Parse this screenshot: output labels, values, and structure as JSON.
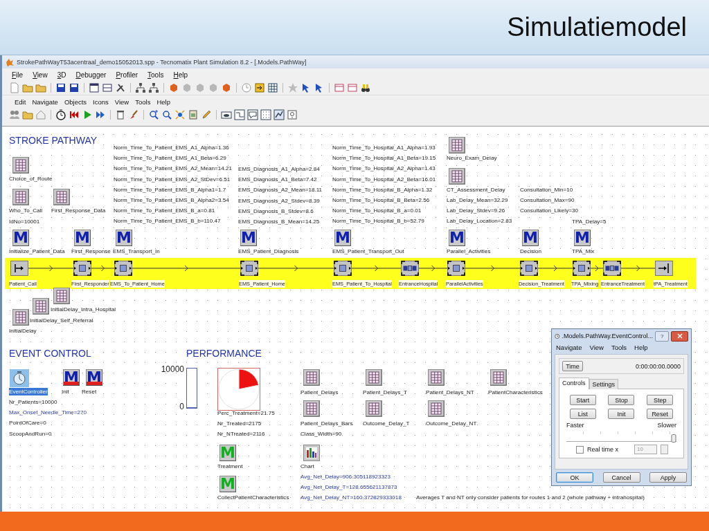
{
  "slide": {
    "title": "Simulatiemodel"
  },
  "window": {
    "title": "StrokePathWayT53acentraal_demo15052013.spp - Tecnomatix Plant Simulation 8.2 - [.Models.PathWay]",
    "menu": [
      "File",
      "View",
      "3D",
      "Debugger",
      "Profiler",
      "Tools",
      "Help"
    ]
  },
  "frame_menu": [
    "Edit",
    "Navigate",
    "Objects",
    "Icons",
    "View",
    "Tools",
    "Help"
  ],
  "canvas": {
    "headings": [
      "STROKE PATHWAY",
      "EVENT CONTROL",
      "PERFORMANCE"
    ],
    "text_blocks": [
      {
        "lines": [
          {
            "text": "IdNo=10001",
            "kind": "plain"
          }
        ]
      },
      {
        "lines": [
          {
            "text": "Norm_Time_To_Patient_EMS_A1_Alpha=1.36",
            "kind": "plain"
          },
          {
            "text": "Norm_Time_To_Patient_EMS_A1_Beta=6.29",
            "kind": "plain"
          },
          {
            "text": "Norm_Time_To_Patient_EMS_A2_Mean=14.21",
            "kind": "plain"
          },
          {
            "text": "Norm_Time_To_Patient_EMS_A2_StDev=6.51",
            "kind": "plain"
          },
          {
            "text": "Norm_Time_To_Patient_EMS_B_Alpha1=1.7",
            "kind": "plain"
          },
          {
            "text": "Norm_Time_To_Patient_EMS_B_Alpha2=3.54",
            "kind": "plain"
          },
          {
            "text": "Norm_Time_To_Patient_EMS_B_a=0.81",
            "kind": "plain"
          },
          {
            "text": "Norm_Time_To_Patient_EMS_B_b=110.47",
            "kind": "plain"
          }
        ]
      },
      {
        "lines": [
          {
            "text": "EMS_Diagnosis_A1_Alpha=2.84",
            "kind": "plain"
          },
          {
            "text": "EMS_Diagnosis_A1_Beta=7.42",
            "kind": "plain"
          },
          {
            "text": "EMS_Diagnosis_A2_Mean=18.11",
            "kind": "plain"
          },
          {
            "text": "EMS_Diagnosis_A2_Stdev=8.39",
            "kind": "plain"
          },
          {
            "text": "EMS_Diagnosis_B_Stdev=8.6",
            "kind": "plain"
          },
          {
            "text": "EMS_Diagnosis_B_Mean=14.25",
            "kind": "plain"
          }
        ]
      },
      {
        "lines": [
          {
            "text": "Norm_Time_To_Hospital_A1_Alpha=1.93",
            "kind": "plain"
          },
          {
            "text": "Norm_Time_To_Hospital_A1_Beta=19.15",
            "kind": "plain"
          },
          {
            "text": "Norm_Time_To_Hospital_A2_Alpha=1.43",
            "kind": "plain"
          },
          {
            "text": "Norm_Time_To_Hospital_A2_Beta=16.01",
            "kind": "plain"
          },
          {
            "text": "Norm_Time_To_Hospital_B_Alpha=1.32",
            "kind": "plain"
          },
          {
            "text": "Norm_Time_To_Hospital_B_Beta=2.56",
            "kind": "plain"
          },
          {
            "text": "Norm_Time_To_Hospital_B_a=0.01",
            "kind": "plain"
          },
          {
            "text": "Norm_Time_To_Hospital_B_b=52.79",
            "kind": "plain"
          }
        ]
      },
      {
        "lines": [
          {
            "text": "Lab_Delay_Mean=32.29",
            "kind": "plain"
          },
          {
            "text": "Lab_Delay_Stdev=9.26",
            "kind": "plain"
          },
          {
            "text": "Lab_Delay_Location=2.83",
            "kind": "plain"
          }
        ]
      },
      {
        "lines": [
          {
            "text": "Consultation_Min=10",
            "kind": "plain"
          },
          {
            "text": "Consultation_Max=90",
            "kind": "plain"
          },
          {
            "text": "Consultation_Likely=30",
            "kind": "plain"
          }
        ]
      },
      {
        "lines": [
          {
            "text": "TPA_Delay=5",
            "kind": "plain"
          }
        ]
      },
      {
        "lines": [
          {
            "text": "InitialDelay",
            "kind": "plain"
          }
        ]
      },
      {
        "lines": [
          {
            "text": "Nr_Patients=10000",
            "kind": "plain"
          },
          {
            "text": "Max_Onset_Needle_Time=270",
            "kind": "watched"
          },
          {
            "text": "PointOfCare=0",
            "kind": "plain"
          },
          {
            "text": "ScoopAndRun=0",
            "kind": "plain"
          }
        ]
      },
      {
        "lines": [
          {
            "text": "Perc_Treatment=21.75",
            "kind": "plain"
          },
          {
            "text": "Nr_Treated=2175",
            "kind": "plain"
          },
          {
            "text": "Nr_NTreated=2116",
            "kind": "plain"
          }
        ]
      },
      {
        "lines": [
          {
            "text": "Class_Width=90",
            "kind": "plain"
          }
        ]
      },
      {
        "lines": [
          {
            "text": "Avg_Net_Delay=906.305118923323",
            "kind": "watched"
          },
          {
            "text": "Avg_Net_Delay_T=128.655621137873",
            "kind": "watched"
          },
          {
            "text": "Avg_Net_Delay_NT=160.372829333018",
            "kind": "watched"
          }
        ]
      },
      {
        "lines": [
          {
            "text": "Averages T and NT only consider patients for routes 1 and 2 (whole pathway + intrahospital)",
            "kind": "plain"
          }
        ]
      }
    ],
    "objects": [
      {
        "kind": "table",
        "label": "Choice_of_Route",
        "selected": false
      },
      {
        "kind": "table",
        "label": "Who_To_Call",
        "selected": false
      },
      {
        "kind": "table",
        "label": "First_Response_Data",
        "selected": false
      },
      {
        "kind": "method",
        "glyph": "M",
        "color": "#1020b0",
        "label": "Initialize_Patient_Data",
        "selected": false
      },
      {
        "kind": "method",
        "glyph": "M",
        "color": "#1020b0",
        "label": "First_Response",
        "selected": false
      },
      {
        "kind": "method",
        "glyph": "M",
        "color": "#1020b0",
        "label": "EMS_Transport_In",
        "selected": false
      },
      {
        "kind": "method",
        "glyph": "M",
        "color": "#1020b0",
        "label": "EMS_Patient_Diagnosis",
        "selected": false
      },
      {
        "kind": "method",
        "glyph": "M",
        "color": "#1020b0",
        "label": "EMS_Patient_Transport_Out",
        "selected": false
      },
      {
        "kind": "table",
        "label": "Neuro_Exam_Delay",
        "selected": false
      },
      {
        "kind": "table",
        "label": "CT_Assessment_Delay",
        "selected": false
      },
      {
        "kind": "method",
        "glyph": "M",
        "color": "#1020b0",
        "label": "Parallel_Activities",
        "selected": false
      },
      {
        "kind": "method",
        "glyph": "M",
        "color": "#1020b0",
        "label": "Decision",
        "selected": false
      },
      {
        "kind": "method",
        "glyph": "M",
        "color": "#1020b0",
        "label": "TPA_Mix",
        "selected": false
      },
      {
        "kind": "table",
        "selected": false
      },
      {
        "kind": "table",
        "label": "InitialDelay_Intra_Hospital",
        "selected": false
      },
      {
        "kind": "table",
        "label": "InitialDelay_Self_Referral",
        "selected": false
      },
      {
        "kind": "controller",
        "label": "EventController",
        "selected": true
      },
      {
        "kind": "init",
        "glyph": "M",
        "color": "#1020b0",
        "label": "Init",
        "selected": false
      },
      {
        "kind": "init",
        "glyph": "M",
        "color": "#1020b0",
        "label": "Reset",
        "selected": false
      },
      {
        "kind": "table",
        "label": "Patient_Delays",
        "selected": false
      },
      {
        "kind": "table",
        "label": "Patient_Delays_T",
        "selected": false
      },
      {
        "kind": "table",
        "label": "Patient_Delays_NT",
        "selected": false
      },
      {
        "kind": "table",
        "label": "PatientCharacteristics",
        "selected": false
      },
      {
        "kind": "table",
        "label": "Patient_Delays_Bars",
        "selected": false
      },
      {
        "kind": "table",
        "label": "Outcome_Delay_T",
        "selected": false
      },
      {
        "kind": "table",
        "label": "Outcome_Delay_NT",
        "selected": false
      },
      {
        "kind": "method",
        "glyph": "M",
        "color": "#10b020",
        "label": "Treatment",
        "selected": false
      },
      {
        "kind": "chart",
        "label": "Chart",
        "selected": false
      },
      {
        "kind": "method",
        "glyph": "M",
        "color": "#10b020",
        "label": "CollectPatientCharacteristics",
        "selected": false
      }
    ],
    "line": [
      {
        "kind": "source",
        "label": "Patient_Call"
      },
      {
        "kind": "station",
        "label": "First_Responder"
      },
      {
        "kind": "station",
        "label": "EMS_To_Patient_Home"
      },
      {
        "kind": "station",
        "label": "EMS_Patient_Home"
      },
      {
        "kind": "station",
        "label": "EMS_Patient_To_Hospital"
      },
      {
        "kind": "parallel",
        "label": "EntranceHospital"
      },
      {
        "kind": "station",
        "label": "ParallelActivities"
      },
      {
        "kind": "station",
        "label": "Decision_Treatment"
      },
      {
        "kind": "station",
        "label": "TPA_Mixing"
      },
      {
        "kind": "parallel",
        "label": "EntranceTreatment"
      },
      {
        "kind": "drain",
        "label": "tPA_Treatment"
      }
    ],
    "bar_display": {
      "max_label": "10000",
      "min_label": "0",
      "level": 0.02
    },
    "pie_display": {
      "chart_data": {
        "type": "pie",
        "values": [
          21.75,
          78.25
        ],
        "colors": [
          "#ee1111",
          "#ffffff"
        ]
      }
    }
  },
  "dialog": {
    "title": ".Models.PathWay.EventControl...",
    "help": "?",
    "menu": [
      "Navigate",
      "View",
      "Tools",
      "Help"
    ],
    "time_button": "Time",
    "time": "0:00:00:00.0000",
    "tabs": [
      {
        "label": "Controls",
        "selected": true
      },
      {
        "label": "Settings",
        "selected": false
      }
    ],
    "buttons": [
      "Start",
      "Stop",
      "Step",
      "List",
      "Init",
      "Reset"
    ],
    "speed": {
      "min_label": "Faster",
      "max_label": "Slower",
      "level": 1
    },
    "real_time": {
      "label": "Real time x",
      "checked": false,
      "value": "10",
      "disabled": true
    },
    "footer_buttons": [
      {
        "label": "OK",
        "default": true
      },
      {
        "label": "Cancel",
        "default": false
      },
      {
        "label": "Apply",
        "default": false
      }
    ]
  }
}
